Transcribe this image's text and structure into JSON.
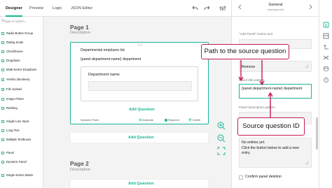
{
  "tabs": [
    "Designer",
    "Preview",
    "Logic",
    "JSON Editor"
  ],
  "toolbox": {
    "search_placeholder": "Type to search...",
    "items": [
      "Radio Button Group",
      "Rating Scale",
      "Checkboxes",
      "Dropdown",
      "Multi-Select Dropdown",
      "Yes/No (Boolean)",
      "File Upload",
      "Image Picker",
      "Ranking",
      "Single-Line Input",
      "Long Text",
      "Multiple Textboxes",
      "Panel",
      "Dynamic Panel",
      "Single-Select Matrix"
    ]
  },
  "canvas": {
    "page1_title": "Page 1",
    "page1_desc": "Description",
    "dynamic_panel_title": "Departmental employee list",
    "dynamic_panel_title_template": "{panel.department-name} department",
    "inner_question_title": "Department name",
    "add_question": "Add Question",
    "footer": {
      "type": "Dynamic Panel",
      "duplicate": "Duplicate",
      "required": "Required",
      "delete": "Delete"
    },
    "page2_title": "Page 2",
    "page2_desc": "Description"
  },
  "properties": {
    "header_title": "General",
    "header_subtitle": "employee-list",
    "add_panel_button_text_label": "\"Add Panel\" button text",
    "remove_button_text": "Remove",
    "panel_title_pattern_label": "Panel title pattern",
    "panel_title_pattern_value": "{panel.department-name} department",
    "panel_description_pattern_label": "Panel description pattern",
    "empty_message": "No entries yet.\nClick the button below to add a new entry.",
    "confirm_deletion_label": "Confirm panel deletion"
  },
  "callouts": {
    "path": "Path to the source question",
    "source_id": "Source question ID"
  },
  "colors": {
    "accent": "#19b394",
    "callout": "#c2185b"
  }
}
